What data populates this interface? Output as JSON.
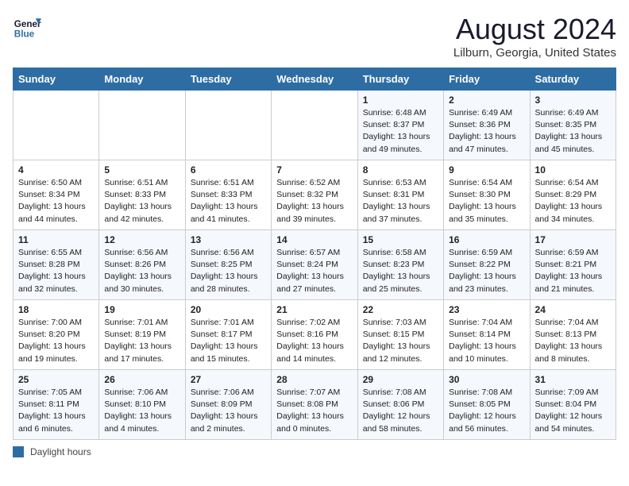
{
  "header": {
    "logo_line1": "General",
    "logo_line2": "Blue",
    "month": "August 2024",
    "location": "Lilburn, Georgia, United States"
  },
  "days_of_week": [
    "Sunday",
    "Monday",
    "Tuesday",
    "Wednesday",
    "Thursday",
    "Friday",
    "Saturday"
  ],
  "weeks": [
    [
      {
        "day": "",
        "info": ""
      },
      {
        "day": "",
        "info": ""
      },
      {
        "day": "",
        "info": ""
      },
      {
        "day": "",
        "info": ""
      },
      {
        "day": "1",
        "info": "Sunrise: 6:48 AM\nSunset: 8:37 PM\nDaylight: 13 hours\nand 49 minutes."
      },
      {
        "day": "2",
        "info": "Sunrise: 6:49 AM\nSunset: 8:36 PM\nDaylight: 13 hours\nand 47 minutes."
      },
      {
        "day": "3",
        "info": "Sunrise: 6:49 AM\nSunset: 8:35 PM\nDaylight: 13 hours\nand 45 minutes."
      }
    ],
    [
      {
        "day": "4",
        "info": "Sunrise: 6:50 AM\nSunset: 8:34 PM\nDaylight: 13 hours\nand 44 minutes."
      },
      {
        "day": "5",
        "info": "Sunrise: 6:51 AM\nSunset: 8:33 PM\nDaylight: 13 hours\nand 42 minutes."
      },
      {
        "day": "6",
        "info": "Sunrise: 6:51 AM\nSunset: 8:33 PM\nDaylight: 13 hours\nand 41 minutes."
      },
      {
        "day": "7",
        "info": "Sunrise: 6:52 AM\nSunset: 8:32 PM\nDaylight: 13 hours\nand 39 minutes."
      },
      {
        "day": "8",
        "info": "Sunrise: 6:53 AM\nSunset: 8:31 PM\nDaylight: 13 hours\nand 37 minutes."
      },
      {
        "day": "9",
        "info": "Sunrise: 6:54 AM\nSunset: 8:30 PM\nDaylight: 13 hours\nand 35 minutes."
      },
      {
        "day": "10",
        "info": "Sunrise: 6:54 AM\nSunset: 8:29 PM\nDaylight: 13 hours\nand 34 minutes."
      }
    ],
    [
      {
        "day": "11",
        "info": "Sunrise: 6:55 AM\nSunset: 8:28 PM\nDaylight: 13 hours\nand 32 minutes."
      },
      {
        "day": "12",
        "info": "Sunrise: 6:56 AM\nSunset: 8:26 PM\nDaylight: 13 hours\nand 30 minutes."
      },
      {
        "day": "13",
        "info": "Sunrise: 6:56 AM\nSunset: 8:25 PM\nDaylight: 13 hours\nand 28 minutes."
      },
      {
        "day": "14",
        "info": "Sunrise: 6:57 AM\nSunset: 8:24 PM\nDaylight: 13 hours\nand 27 minutes."
      },
      {
        "day": "15",
        "info": "Sunrise: 6:58 AM\nSunset: 8:23 PM\nDaylight: 13 hours\nand 25 minutes."
      },
      {
        "day": "16",
        "info": "Sunrise: 6:59 AM\nSunset: 8:22 PM\nDaylight: 13 hours\nand 23 minutes."
      },
      {
        "day": "17",
        "info": "Sunrise: 6:59 AM\nSunset: 8:21 PM\nDaylight: 13 hours\nand 21 minutes."
      }
    ],
    [
      {
        "day": "18",
        "info": "Sunrise: 7:00 AM\nSunset: 8:20 PM\nDaylight: 13 hours\nand 19 minutes."
      },
      {
        "day": "19",
        "info": "Sunrise: 7:01 AM\nSunset: 8:19 PM\nDaylight: 13 hours\nand 17 minutes."
      },
      {
        "day": "20",
        "info": "Sunrise: 7:01 AM\nSunset: 8:17 PM\nDaylight: 13 hours\nand 15 minutes."
      },
      {
        "day": "21",
        "info": "Sunrise: 7:02 AM\nSunset: 8:16 PM\nDaylight: 13 hours\nand 14 minutes."
      },
      {
        "day": "22",
        "info": "Sunrise: 7:03 AM\nSunset: 8:15 PM\nDaylight: 13 hours\nand 12 minutes."
      },
      {
        "day": "23",
        "info": "Sunrise: 7:04 AM\nSunset: 8:14 PM\nDaylight: 13 hours\nand 10 minutes."
      },
      {
        "day": "24",
        "info": "Sunrise: 7:04 AM\nSunset: 8:13 PM\nDaylight: 13 hours\nand 8 minutes."
      }
    ],
    [
      {
        "day": "25",
        "info": "Sunrise: 7:05 AM\nSunset: 8:11 PM\nDaylight: 13 hours\nand 6 minutes."
      },
      {
        "day": "26",
        "info": "Sunrise: 7:06 AM\nSunset: 8:10 PM\nDaylight: 13 hours\nand 4 minutes."
      },
      {
        "day": "27",
        "info": "Sunrise: 7:06 AM\nSunset: 8:09 PM\nDaylight: 13 hours\nand 2 minutes."
      },
      {
        "day": "28",
        "info": "Sunrise: 7:07 AM\nSunset: 8:08 PM\nDaylight: 13 hours\nand 0 minutes."
      },
      {
        "day": "29",
        "info": "Sunrise: 7:08 AM\nSunset: 8:06 PM\nDaylight: 12 hours\nand 58 minutes."
      },
      {
        "day": "30",
        "info": "Sunrise: 7:08 AM\nSunset: 8:05 PM\nDaylight: 12 hours\nand 56 minutes."
      },
      {
        "day": "31",
        "info": "Sunrise: 7:09 AM\nSunset: 8:04 PM\nDaylight: 12 hours\nand 54 minutes."
      }
    ]
  ],
  "footer": {
    "legend_label": "Daylight hours"
  }
}
